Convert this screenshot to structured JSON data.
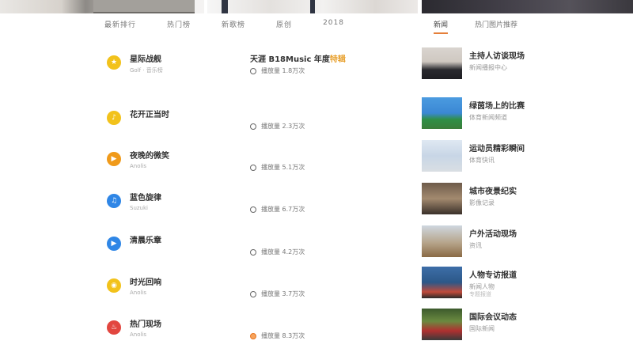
{
  "colors": {
    "accent": "#e57f3a",
    "highlight": "#e8a12f"
  },
  "category_tabs": [
    "最新排行",
    "热门榜",
    "新歌榜",
    "原创",
    "2018"
  ],
  "right_tabs": {
    "items": [
      "新闻",
      "热门图片推荐"
    ],
    "active_index": 0
  },
  "rows": [
    {
      "name": "星际战舰",
      "sub": "Golf · 音乐榜",
      "icon": "star-icon",
      "icon_color": "#f2c21b",
      "icon_glyph": "★",
      "meta_head": "天涯 B18Music 年度",
      "meta_head_hl": "特辑",
      "meta": "播放量 1.8万次",
      "circle": "plain"
    },
    {
      "name": "花开正当时",
      "sub": "",
      "icon": "music-icon",
      "icon_color": "#f2c21b",
      "icon_glyph": "♪",
      "meta": "播放量 2.3万次",
      "circle": "plain"
    },
    {
      "name": "夜晚的微笑",
      "sub": "Anolis",
      "icon": "play-icon",
      "icon_color": "#f09a1a",
      "icon_glyph": "▶",
      "meta": "播放量 5.1万次",
      "circle": "plain"
    },
    {
      "name": "蓝色旋律",
      "sub": "Suzuki",
      "icon": "note-icon",
      "icon_color": "#2f86e6",
      "icon_glyph": "♫",
      "meta": "播放量 6.7万次",
      "circle": "plain"
    },
    {
      "name": "清晨乐章",
      "sub": "",
      "icon": "video-icon",
      "icon_color": "#2f86e6",
      "icon_glyph": "▶",
      "meta": "播放量 4.2万次",
      "circle": "plain"
    },
    {
      "name": "时光回响",
      "sub": "Anolis",
      "icon": "headphone-icon",
      "icon_color": "#f2c21b",
      "icon_glyph": "◉",
      "meta": "播放量 3.7万次",
      "circle": "plain"
    },
    {
      "name": "热门现场",
      "sub": "Anolis",
      "icon": "fire-icon",
      "icon_color": "#e2463f",
      "icon_glyph": "♨",
      "meta": "播放量 8.3万次",
      "circle": "orange"
    }
  ],
  "news": [
    {
      "title": "主持人访谈现场",
      "sub": "新闻播报中心",
      "sub2": "",
      "thumb": "portrait"
    },
    {
      "title": "绿茵场上的比赛",
      "sub": "体育新闻频道",
      "sub2": "",
      "thumb": "field"
    },
    {
      "title": "运动员精彩瞬间",
      "sub": "体育快讯",
      "sub2": "",
      "thumb": "athletes"
    },
    {
      "title": "城市夜景纪实",
      "sub": "影像记录",
      "sub2": "",
      "thumb": "street"
    },
    {
      "title": "户外活动现场",
      "sub": "资讯",
      "sub2": "",
      "thumb": "outdoor"
    },
    {
      "title": "人物专访报道",
      "sub": "新闻人物",
      "sub2": "专题报道",
      "thumb": "person"
    },
    {
      "title": "国际会议动态",
      "sub": "国际新闻",
      "sub2": "",
      "thumb": "meeting"
    }
  ]
}
